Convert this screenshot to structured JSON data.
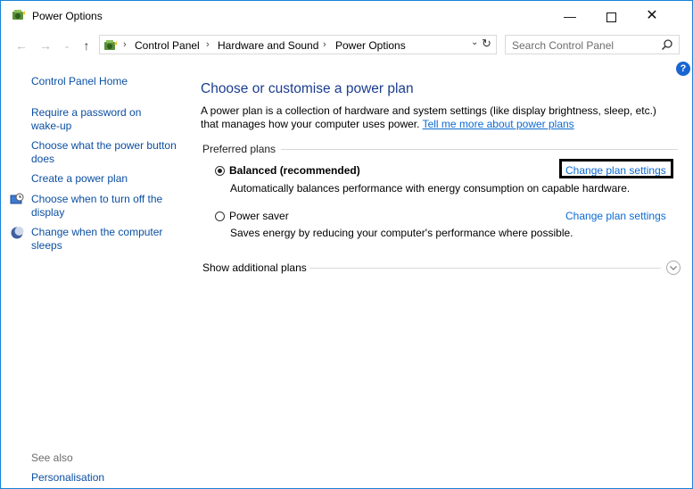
{
  "window": {
    "title": "Power Options",
    "minimize_symbol": "—",
    "close_symbol": "✕"
  },
  "nav": {
    "back_symbol": "←",
    "forward_symbol": "→",
    "recent_symbol": "⌄",
    "up_symbol": "↑",
    "breadcrumbs": [
      "Control Panel",
      "Hardware and Sound",
      "Power Options"
    ],
    "separator": "›",
    "dropdown_symbol": "⌄",
    "refresh_symbol": "↻"
  },
  "search": {
    "placeholder": "Search Control Panel"
  },
  "help_symbol": "?",
  "sidebar": {
    "home": "Control Panel Home",
    "items": [
      "Require a password on wake-up",
      "Choose what the power button does",
      "Create a power plan",
      "Choose when to turn off the display",
      "Change when the computer sleeps"
    ],
    "see_also": "See also",
    "personalisation": "Personalisation"
  },
  "main": {
    "heading": "Choose or customise a power plan",
    "description": "A power plan is a collection of hardware and system settings (like display brightness, sleep, etc.) that manages how your computer uses power.",
    "learn_more": "Tell me more about power plans",
    "preferred_label": "Preferred plans",
    "plans": [
      {
        "name": "Balanced (recommended)",
        "selected": true,
        "description": "Automatically balances performance with energy consumption on capable hardware.",
        "link": "Change plan settings"
      },
      {
        "name": "Power saver",
        "selected": false,
        "description": "Saves energy by reducing your computer's performance where possible.",
        "link": "Change plan settings"
      }
    ],
    "additional_plans": "Show additional plans"
  },
  "colors": {
    "accent": "#1883d7",
    "link": "#0b6bd3",
    "heading": "#1b3d8f"
  }
}
